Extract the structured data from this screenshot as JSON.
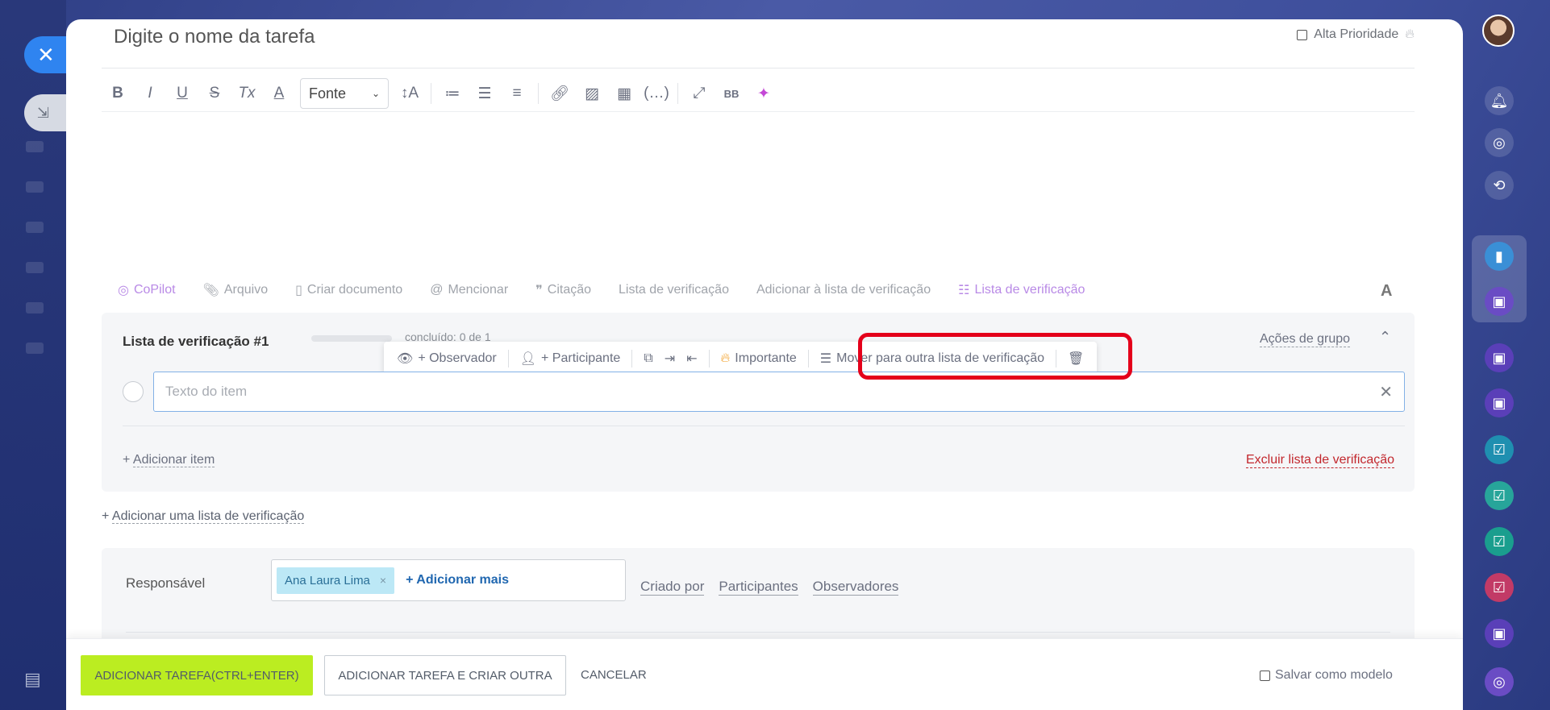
{
  "task": {
    "title_placeholder": "Digite o nome da tarefa",
    "high_priority_label": "Alta Prioridade"
  },
  "editor_toolbar": {
    "font_select": "Fonte",
    "icons": [
      "bold-icon",
      "italic-icon",
      "underline-icon",
      "strikethrough-icon",
      "clear-format-icon",
      "font-color-icon",
      "font-size-icon",
      "numbered-list-icon",
      "bullet-list-icon",
      "align-icon",
      "link-icon",
      "image-icon",
      "table-icon",
      "code-icon",
      "fullscreen-icon",
      "bbcode-icon",
      "ai-image-icon"
    ],
    "bold": "B",
    "italic": "I",
    "underline": "U",
    "strike": "S",
    "clear": "Tx",
    "color": "A",
    "size": "↕A",
    "bbcode": "BB"
  },
  "actions": {
    "copilot": "CoPilot",
    "file": "Arquivo",
    "create_doc": "Criar documento",
    "mention": "Mencionar",
    "quote": "Citação",
    "checklist": "Lista de verificação",
    "add_to_checklist": "Adicionar à lista de verificação",
    "checklist2": "Lista de verificação",
    "font_toggle": "A"
  },
  "checklist": {
    "title": "Lista de verificação #1",
    "status": "concluído: 0 de 1",
    "progress": 0,
    "group_actions": "Ações de grupo",
    "item_placeholder": "Texto do item",
    "add_item_prefix": "+",
    "add_item": "Adicionar item",
    "delete": "Excluir lista de verificação"
  },
  "item_toolbar": {
    "observer": "+ Observador",
    "participant": "+ Participante",
    "important": "Importante",
    "move": "Mover para outra lista de verificação"
  },
  "add_checklist_prefix": "+",
  "add_checklist": "Adicionar uma lista de verificação",
  "people": {
    "responsible_label": "Responsável",
    "responsible_tag": "Ana Laura Lima",
    "tag_remove": "×",
    "add_more": "+ Adicionar mais",
    "created_by": "Criado por",
    "participants": "Participantes",
    "observers": "Observadores"
  },
  "footer": {
    "add_task": "ADICIONAR TAREFA(CTRL+ENTER)",
    "add_and_create": "ADICIONAR TAREFA E CRIAR OUTRA",
    "cancel": "CANCELAR",
    "save_template": "Salvar como modelo"
  },
  "colors": {
    "accent_green": "#bbed21",
    "highlight_red": "#e4001b",
    "link_blue": "#2067b0",
    "delete_red": "#c2272d"
  }
}
